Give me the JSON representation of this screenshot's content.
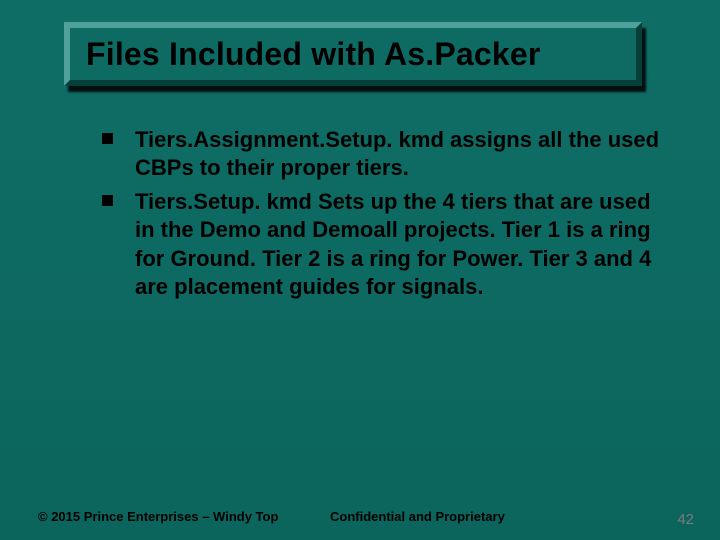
{
  "title": "Files Included with As.Packer",
  "bullets": [
    "Tiers.Assignment.Setup. kmd assigns all the used CBPs to their proper tiers.",
    "Tiers.Setup. kmd Sets up the 4 tiers that are used in the Demo and Demoall projects. Tier 1 is a ring for Ground. Tier 2 is a ring for Power. Tier 3 and 4 are placement guides for signals."
  ],
  "footer": {
    "left": "© 2015 Prince Enterprises – Windy Top",
    "center": "Confidential and Proprietary",
    "page": "42"
  }
}
